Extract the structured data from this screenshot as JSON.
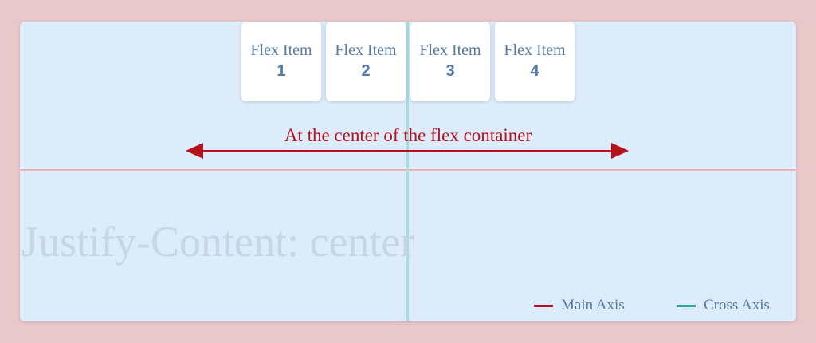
{
  "items": [
    {
      "label": "Flex Item",
      "number": "1"
    },
    {
      "label": "Flex Item",
      "number": "2"
    },
    {
      "label": "Flex Item",
      "number": "3"
    },
    {
      "label": "Flex Item",
      "number": "4"
    }
  ],
  "caption": "At the center of the flex container",
  "watermark": "Justify-Content: center",
  "legend": {
    "main_axis": "Main Axis",
    "cross_axis": "Cross Axis"
  },
  "colors": {
    "main_axis": "#b5121b",
    "cross_axis": "#2aa89a",
    "item_text": "#547aa5"
  },
  "icons": {
    "arrow": "double-headed-arrow"
  }
}
